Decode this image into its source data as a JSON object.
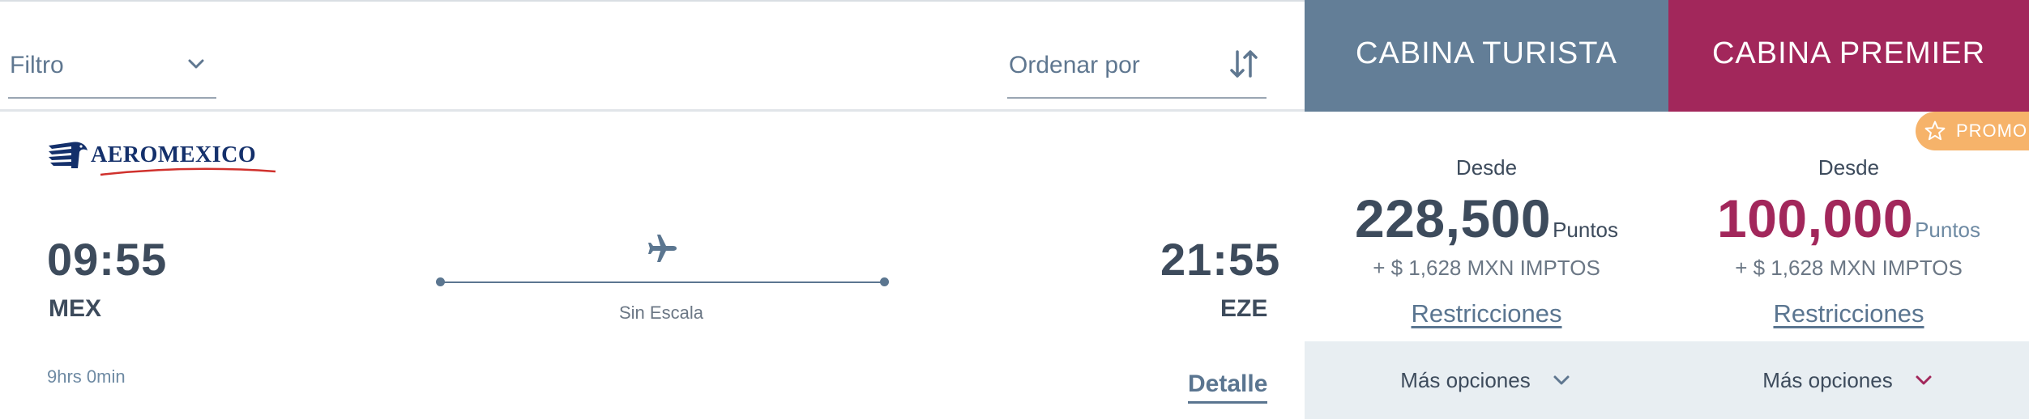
{
  "toolbar": {
    "filter_label": "Filtro",
    "sort_label": "Ordenar por"
  },
  "cabins": {
    "turista": {
      "label": "CABINA TURISTA",
      "color": "#637e97"
    },
    "premier": {
      "label": "CABINA PREMIER",
      "color": "#a2275b"
    }
  },
  "promo": {
    "label": "PROMO",
    "color": "#f6b36a"
  },
  "flight": {
    "airline_logo_text": "AEROMEXICO",
    "departure_time": "09:55",
    "departure_code": "MEX",
    "arrival_time": "21:55",
    "arrival_code": "EZE",
    "stops": "Sin Escala",
    "duration": "9hrs 0min",
    "details_link": "Detalle"
  },
  "fares": {
    "turista": {
      "from_label": "Desde",
      "points": "228,500",
      "points_unit": "Puntos",
      "taxes": "+ $ 1,628 MXN IMPTOS",
      "restrictions": "Restricciones",
      "more_options": "Más opciones"
    },
    "premier": {
      "from_label": "Desde",
      "points": "100,000",
      "points_unit": "Puntos",
      "taxes": "+ $ 1,628 MXN IMPTOS",
      "restrictions": "Restricciones",
      "more_options": "Más opciones"
    }
  },
  "icons": {
    "filter": "chevron-down-icon",
    "sort": "sort-icon",
    "promo": "star-icon",
    "route": "airplane-icon",
    "more_turista": "chevron-down-icon",
    "more_premier": "chevron-down-icon"
  }
}
